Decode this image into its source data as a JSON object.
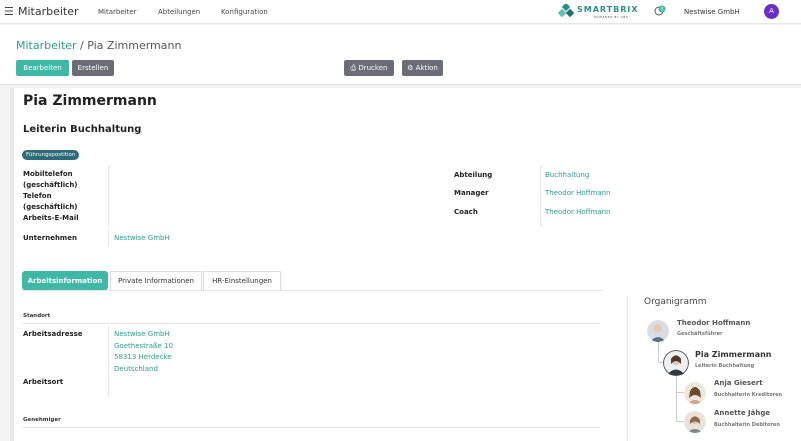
{
  "navbar": {
    "app_name": "Mitarbeiter",
    "menu": [
      "Mitarbeiter",
      "Abteilungen",
      "Konfiguration"
    ],
    "logo_text": "SMARTBRIX",
    "logo_sub": "POWERED BY OBS",
    "company": "Nestwise GmbH",
    "avatar_letter": "A",
    "avatar_color": "#6b2fc9",
    "icons": [
      "menu-icon",
      "chat-icon"
    ]
  },
  "breadcrumb": {
    "parent": "Mitarbeiter",
    "separator": " / ",
    "current": "Pia Zimmermann"
  },
  "actions": {
    "edit": "Bearbeiten",
    "create": "Erstellen",
    "print": "⎙ Drucken",
    "action": "⚙ Aktion"
  },
  "employee": {
    "name": "Pia Zimmermann",
    "job_title": "Leiterin Buchhaltung",
    "tag": "Führungspostition",
    "left_fields": {
      "mobile_label_1": "Mobiltelefon",
      "mobile_label_2": "(geschäftlich)",
      "phone_label_1": "Telefon",
      "phone_label_2": "(geschäftlich)",
      "email_label": "Arbeits-E-Mail",
      "company_label": "Unternehmen",
      "company_value": "Nestwise GmbH"
    },
    "right_fields": [
      {
        "label": "Abteilung",
        "value": "Buchhaltung"
      },
      {
        "label": "Manager",
        "value": "Theodor Hoffmann"
      },
      {
        "label": "Coach",
        "value": "Theodor Hoffmann"
      }
    ]
  },
  "tabs": [
    "Arbeitsinformation",
    "Private Informationen",
    "HR-Einstellungen"
  ],
  "work_info": {
    "location_section": "Standort",
    "address_label": "Arbeitsadresse",
    "address_lines": [
      "Nestwise GmbH",
      "Goethestraße 10",
      "58313 Herdecke",
      "Deutschland"
    ],
    "worksite_label": "Arbeitsort",
    "approver_section": "Genehmiger"
  },
  "org_chart": {
    "title": "Organigramm",
    "nodes": [
      {
        "name": "Theodor Hoffmann",
        "role": "Geschäftsführer"
      },
      {
        "name": "Pia Zimmermann",
        "role": "Leiterin Buchhaltung"
      },
      {
        "name": "Anja Giesert",
        "role": "Buchhalterin Kreditoren"
      },
      {
        "name": "Annette Jähge",
        "role": "Buchhalterin Debitoren"
      }
    ]
  },
  "colors": {
    "accent": "#3fb8a8",
    "link": "#2a9d8f",
    "tag": "#2e6b78",
    "secondary_button": "#6c6c77"
  }
}
